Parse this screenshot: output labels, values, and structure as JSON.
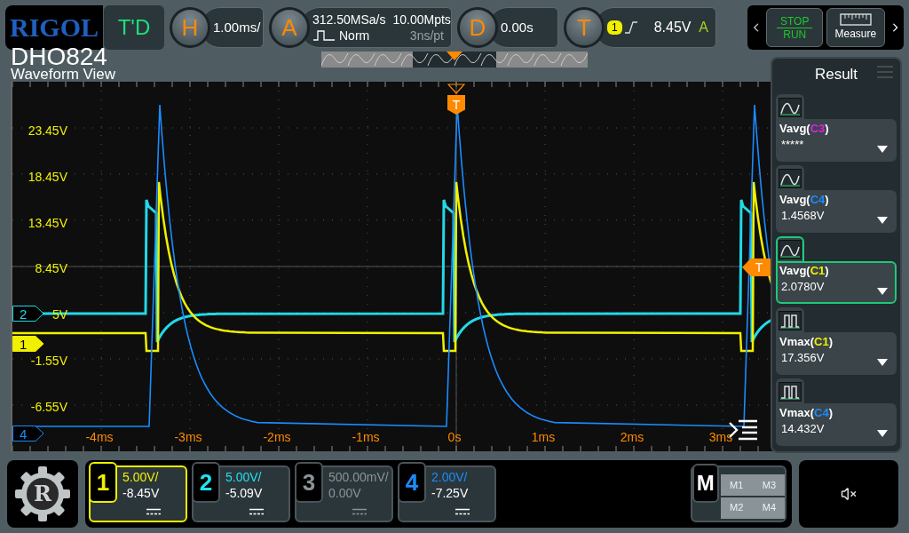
{
  "brand": {
    "logo": "RIGOL",
    "model": "DHO824"
  },
  "top_bar": {
    "mode": "T'D",
    "horizontal": {
      "letter": "H",
      "scale": "1.00ms/"
    },
    "acquire": {
      "letter": "A",
      "sample_rate": "312.50MSa/s",
      "memory_depth": "10.00Mpts",
      "mode": "Norm",
      "resolution": "3ns/pt"
    },
    "delay": {
      "letter": "D",
      "value": "0.00s"
    },
    "trigger": {
      "letter": "T",
      "source": "1",
      "level": "8.45V",
      "sweep": "A"
    },
    "controls": {
      "stop": "STOP",
      "run": "RUN",
      "measure": "Measure"
    }
  },
  "view_title": "Waveform View",
  "waveform": {
    "y_labels": [
      "23.45V",
      "18.45V",
      "13.45V",
      "8.45V",
      "5V",
      "-1.55V",
      "-6.55V"
    ],
    "x_labels": [
      "-4ms",
      "-3ms",
      "-2ms",
      "-1ms",
      "0s",
      "1ms",
      "2ms",
      "3ms"
    ],
    "trigger_marker": "T",
    "level_marker": "T",
    "channel_markers": [
      {
        "label": "2",
        "color": "#22d8e8",
        "selected": false
      },
      {
        "label": "1",
        "color": "#f0f000",
        "selected": true
      },
      {
        "label": "4",
        "color": "#1a8cff",
        "selected": false
      }
    ]
  },
  "result_panel": {
    "title": "Result",
    "measurements": [
      {
        "kind": "average",
        "function": "Vavg(",
        "source": "C3",
        "color": "#e020e0",
        "suffix": ")",
        "value": "*****",
        "selected": false
      },
      {
        "kind": "average",
        "function": "Vavg(",
        "source": "C4",
        "color": "#1a8cff",
        "suffix": ")",
        "value": "1.4568V",
        "selected": false
      },
      {
        "kind": "average",
        "function": "Vavg(",
        "source": "C1",
        "color": "#f0f000",
        "suffix": ")",
        "value": "2.0780V",
        "selected": true
      },
      {
        "kind": "maximum",
        "function": "Vmax(",
        "source": "C1",
        "color": "#f0f000",
        "suffix": ")",
        "value": "17.356V",
        "selected": false
      },
      {
        "kind": "maximum",
        "function": "Vmax(",
        "source": "C4",
        "color": "#1a8cff",
        "suffix": ")",
        "value": "14.432V",
        "selected": false
      }
    ]
  },
  "logo_letter": "R",
  "channels": [
    {
      "number": "1",
      "scale": "5.00V/",
      "offset": "-8.45V",
      "color": "#f0f000",
      "enabled": true,
      "selected": true
    },
    {
      "number": "2",
      "scale": "5.00V/",
      "offset": "-5.09V",
      "color": "#22e0f0",
      "enabled": true,
      "selected": false
    },
    {
      "number": "3",
      "scale": "500.00mV/",
      "offset": "0.00V",
      "color": "#8a9498",
      "enabled": false,
      "selected": false
    },
    {
      "number": "4",
      "scale": "2.00V/",
      "offset": "-7.25V",
      "color": "#1a8cff",
      "enabled": true,
      "selected": false
    }
  ],
  "math": {
    "label": "M",
    "slots": [
      "M1",
      "M3",
      "M2",
      "M4"
    ]
  },
  "sound": {
    "muted": true
  }
}
